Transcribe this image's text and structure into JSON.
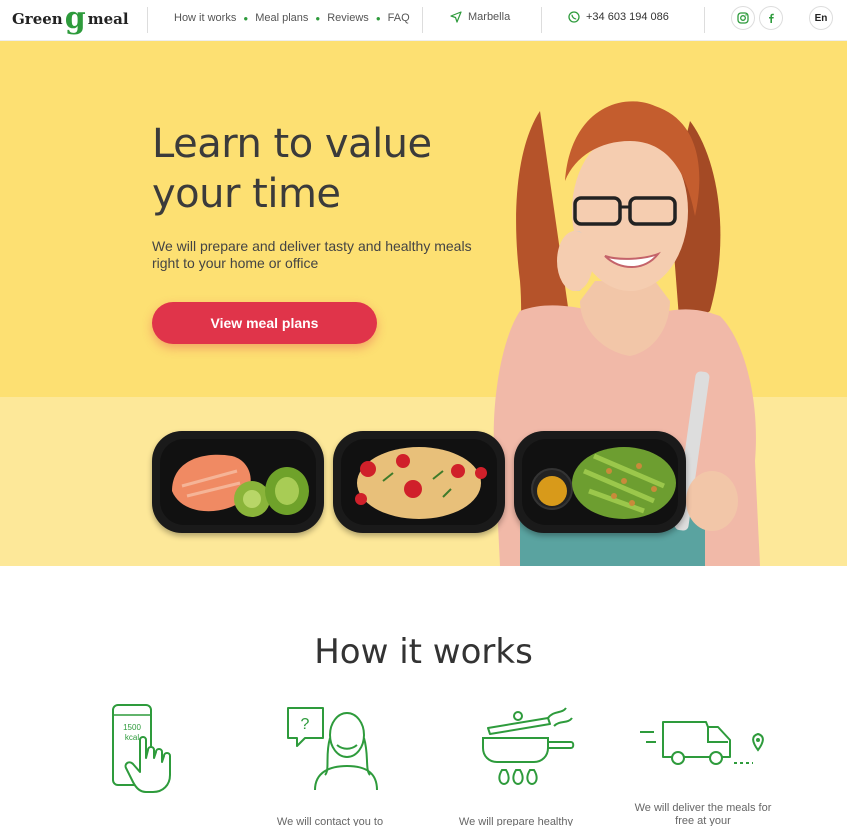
{
  "header": {
    "logo_left": "Green",
    "logo_mark": "g",
    "logo_right": "meal",
    "nav": [
      "How it works",
      "Meal plans",
      "Reviews",
      "FAQ"
    ],
    "location": "Marbella",
    "phone": "+34 603 194 086",
    "lang": "En"
  },
  "hero": {
    "title": "Learn to value your time",
    "subtitle": "We will prepare and deliver tasty and healthy meals right to your home or office",
    "cta": "View meal plans"
  },
  "how": {
    "title": "How it works",
    "steps": [
      {
        "icon": "phone-kcal-icon",
        "icon_text_1": "1500",
        "icon_text_2": "kcal",
        "text": ""
      },
      {
        "icon": "consultant-icon",
        "icon_text_1": "?",
        "text": "We will contact you to"
      },
      {
        "icon": "cooking-pot-icon",
        "text": "We will prepare healthy"
      },
      {
        "icon": "delivery-van-icon",
        "text": "We will deliver the meals for free at your"
      }
    ]
  },
  "colors": {
    "accent": "#2e9b3c",
    "hero_bg": "#fde072",
    "cta": "#e0344a"
  }
}
